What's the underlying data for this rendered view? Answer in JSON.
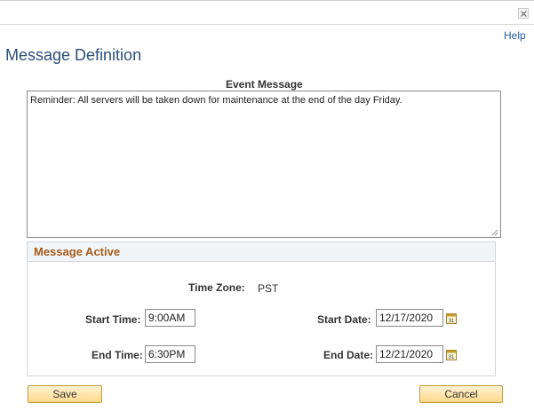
{
  "window": {
    "close_icon": "close-icon",
    "help_label": "Help"
  },
  "page": {
    "title": "Message Definition"
  },
  "event_message": {
    "label": "Event Message",
    "value": "Reminder: All servers will be taken down for maintenance at the end of the day Friday."
  },
  "message_active": {
    "title": "Message Active",
    "time_zone_label": "Time Zone:",
    "time_zone_value": "PST",
    "start_time_label": "Start Time:",
    "start_time_value": "9:00AM",
    "end_time_label": "End Time:",
    "end_time_value": "6:30PM",
    "start_date_label": "Start Date:",
    "start_date_value": "12/17/2020",
    "end_date_label": "End Date:",
    "end_date_value": "12/21/2020",
    "calendar_icon": "calendar-icon",
    "calendar_icon_text": "31"
  },
  "actions": {
    "save_label": "Save",
    "cancel_label": "Cancel"
  },
  "colors": {
    "title": "#2b4d7a",
    "link": "#1f5fa6",
    "section_title": "#a55a1b",
    "button_top": "#fff3d6",
    "button_bottom": "#ffd98a"
  }
}
